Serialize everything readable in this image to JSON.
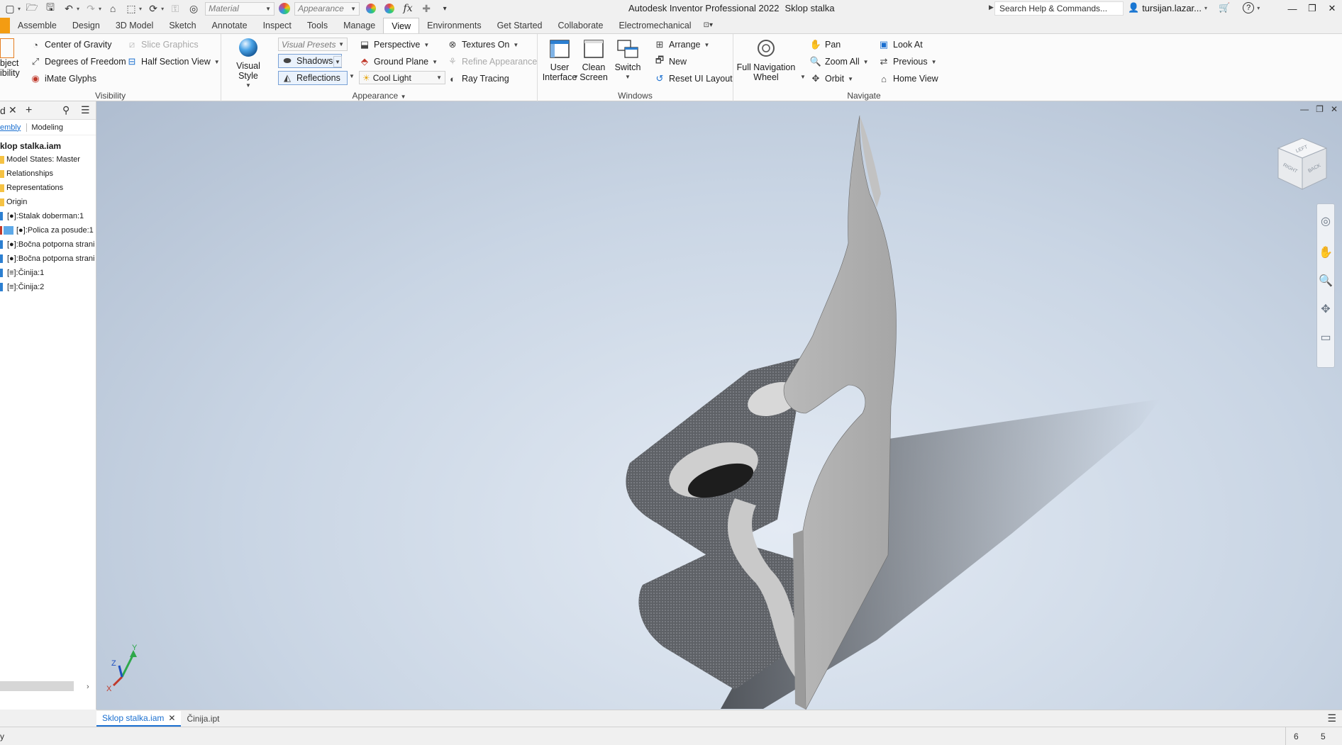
{
  "titlebar": {
    "material_placeholder": "Material",
    "appearance_placeholder": "Appearance",
    "app_name": "Autodesk Inventor Professional 2022",
    "document_name": "Sklop stalka",
    "help_search": "Search Help & Commands...",
    "user_name": "tursijan.lazar..."
  },
  "tabs": [
    "Assemble",
    "Design",
    "3D Model",
    "Sketch",
    "Annotate",
    "Inspect",
    "Tools",
    "Manage",
    "View",
    "Environments",
    "Get Started",
    "Collaborate",
    "Electromechanical"
  ],
  "active_tab": "View",
  "ribbon": {
    "visibility": {
      "title": "Visibility",
      "object_visibility_l1": "bject",
      "object_visibility_l2": "ibility",
      "center_of_gravity": "Center of Gravity",
      "degrees_of_freedom": "Degrees of Freedom",
      "imate_glyphs": "iMate Glyphs",
      "slice_graphics": "Slice Graphics",
      "half_section_view": "Half Section View"
    },
    "appearance": {
      "title": "Appearance",
      "visual_style": "Visual Style",
      "visual_presets": "Visual Presets",
      "shadows": "Shadows",
      "reflections": "Reflections",
      "perspective": "Perspective",
      "ground_plane": "Ground Plane",
      "cool_light": "Cool Light",
      "textures_on": "Textures On",
      "refine_appearance": "Refine Appearance",
      "ray_tracing": "Ray Tracing"
    },
    "windows": {
      "title": "Windows",
      "user_interface_l1": "User",
      "user_interface_l2": "Interface",
      "clean_screen_l1": "Clean",
      "clean_screen_l2": "Screen",
      "switch": "Switch",
      "arrange": "Arrange",
      "new": "New",
      "reset_ui_layout": "Reset UI Layout"
    },
    "navigate": {
      "title": "Navigate",
      "full_nav_wheel_l1": "Full Navigation",
      "full_nav_wheel_l2": "Wheel",
      "pan": "Pan",
      "zoom_all": "Zoom All",
      "orbit": "Orbit",
      "look_at": "Look At",
      "previous": "Previous",
      "home_view": "Home View"
    }
  },
  "browser": {
    "tab_assembly": "embly",
    "tab_modeling": "Modeling",
    "root": "klop stalka.iam",
    "folders": [
      "Model States: Master",
      "Relationships",
      "Representations",
      "Origin"
    ],
    "parts": [
      "[●]:Stalak doberman:1",
      "[●]:Polica za posude:1",
      "[●]:Bočna potporna strani",
      "[●]:Bočna potporna strani",
      "[≡]:Činija:1",
      "[≡]:Činija:2"
    ]
  },
  "viewcube": {
    "top": "LEFT",
    "left": "RIGHT",
    "right": "BACK"
  },
  "axes": {
    "x": "X",
    "y": "Y",
    "z": "Z"
  },
  "doc_tabs": [
    "Sklop stalka.iam",
    "Činija.ipt"
  ],
  "active_doc": "Sklop stalka.iam",
  "statusbar": {
    "left": "y",
    "count1": "6",
    "count2": "5"
  }
}
